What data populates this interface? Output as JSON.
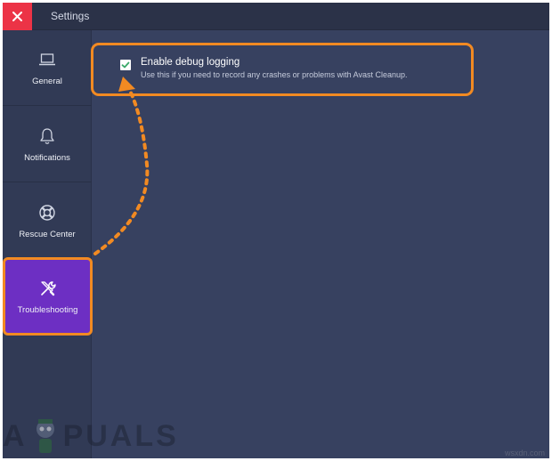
{
  "window": {
    "title": "Settings"
  },
  "sidebar": {
    "items": [
      {
        "label": "General",
        "icon": "laptop-icon",
        "active": false
      },
      {
        "label": "Notifications",
        "icon": "bell-icon",
        "active": false
      },
      {
        "label": "Rescue Center",
        "icon": "lifebuoy-icon",
        "active": false
      },
      {
        "label": "Troubleshooting",
        "icon": "tools-icon",
        "active": true
      }
    ]
  },
  "debug_option": {
    "title": "Enable debug logging",
    "description": "Use this if you need to record any crashes or problems with Avast Cleanup.",
    "checked": true
  },
  "watermark": {
    "prefix": "A",
    "suffix": "PUALS",
    "site": "wsxdn.com"
  },
  "colors": {
    "background": "#374160",
    "sidebar": "#313a55",
    "close_button": "#ec3346",
    "active_item": "#6d2fc3",
    "highlight": "#f28a22"
  }
}
